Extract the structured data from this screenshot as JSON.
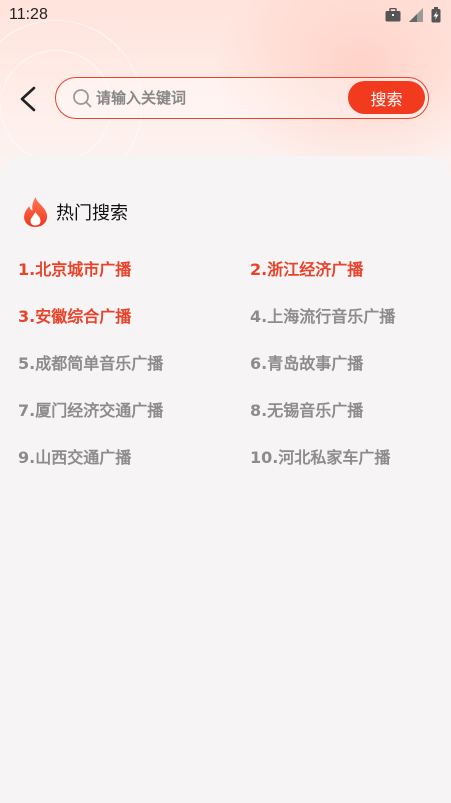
{
  "status_bar": {
    "time": "11:28",
    "icons": [
      "briefcase-icon",
      "signal-icon",
      "battery-icon"
    ]
  },
  "search": {
    "placeholder": "请输入关键词",
    "button_label": "搜索"
  },
  "hot_search": {
    "title": "热门搜索",
    "items": [
      {
        "label": "1.北京城市广播",
        "highlight": true
      },
      {
        "label": "2.浙江经济广播",
        "highlight": true
      },
      {
        "label": "3.安徽综合广播",
        "highlight": true
      },
      {
        "label": "4.上海流行音乐广播",
        "highlight": false
      },
      {
        "label": "5.成都简单音乐广播",
        "highlight": false
      },
      {
        "label": "6.青岛故事广播",
        "highlight": false
      },
      {
        "label": "7.厦门经济交通广播",
        "highlight": false
      },
      {
        "label": "8.无锡音乐广播",
        "highlight": false
      },
      {
        "label": "9.山西交通广播",
        "highlight": false
      },
      {
        "label": "10.河北私家车广播",
        "highlight": false
      }
    ]
  },
  "colors": {
    "accent": "#f23a1f",
    "highlight_text": "#e8432b",
    "normal_text": "#8c8c8c"
  }
}
